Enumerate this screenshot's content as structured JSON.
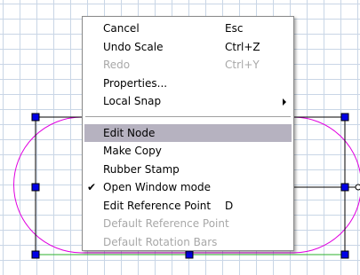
{
  "colors": {
    "grid_line": "#c9d6e6",
    "shape_outline": "#e000e0",
    "bounding_box": "#000000",
    "bottom_edge": "#2db02d",
    "handle_fill": "#0000e6",
    "menu_highlight": "#b6b2c0",
    "disabled_text": "#a8a8a8"
  },
  "context_menu": {
    "items": [
      {
        "label": "Cancel",
        "shortcut": "Esc",
        "enabled": true
      },
      {
        "label": "Undo Scale",
        "shortcut": "Ctrl+Z",
        "enabled": true
      },
      {
        "label": "Redo",
        "shortcut": "Ctrl+Y",
        "enabled": false
      },
      {
        "label": "Properties...",
        "shortcut": "",
        "enabled": true
      },
      {
        "label": "Local Snap",
        "shortcut": "",
        "enabled": true,
        "submenu": true
      },
      {
        "label": "Edit Node",
        "shortcut": "",
        "enabled": true,
        "highlighted": true
      },
      {
        "label": "Make Copy",
        "shortcut": "",
        "enabled": true
      },
      {
        "label": "Rubber Stamp",
        "shortcut": "",
        "enabled": true
      },
      {
        "label": "Open Window mode",
        "shortcut": "",
        "enabled": true,
        "checked": true
      },
      {
        "label": "Edit Reference Point",
        "shortcut": "D",
        "enabled": true
      },
      {
        "label": "Default Reference Point",
        "shortcut": "",
        "enabled": false
      },
      {
        "label": "Default Rotation Bars",
        "shortcut": "",
        "enabled": false
      }
    ],
    "check_glyph": "✔"
  }
}
